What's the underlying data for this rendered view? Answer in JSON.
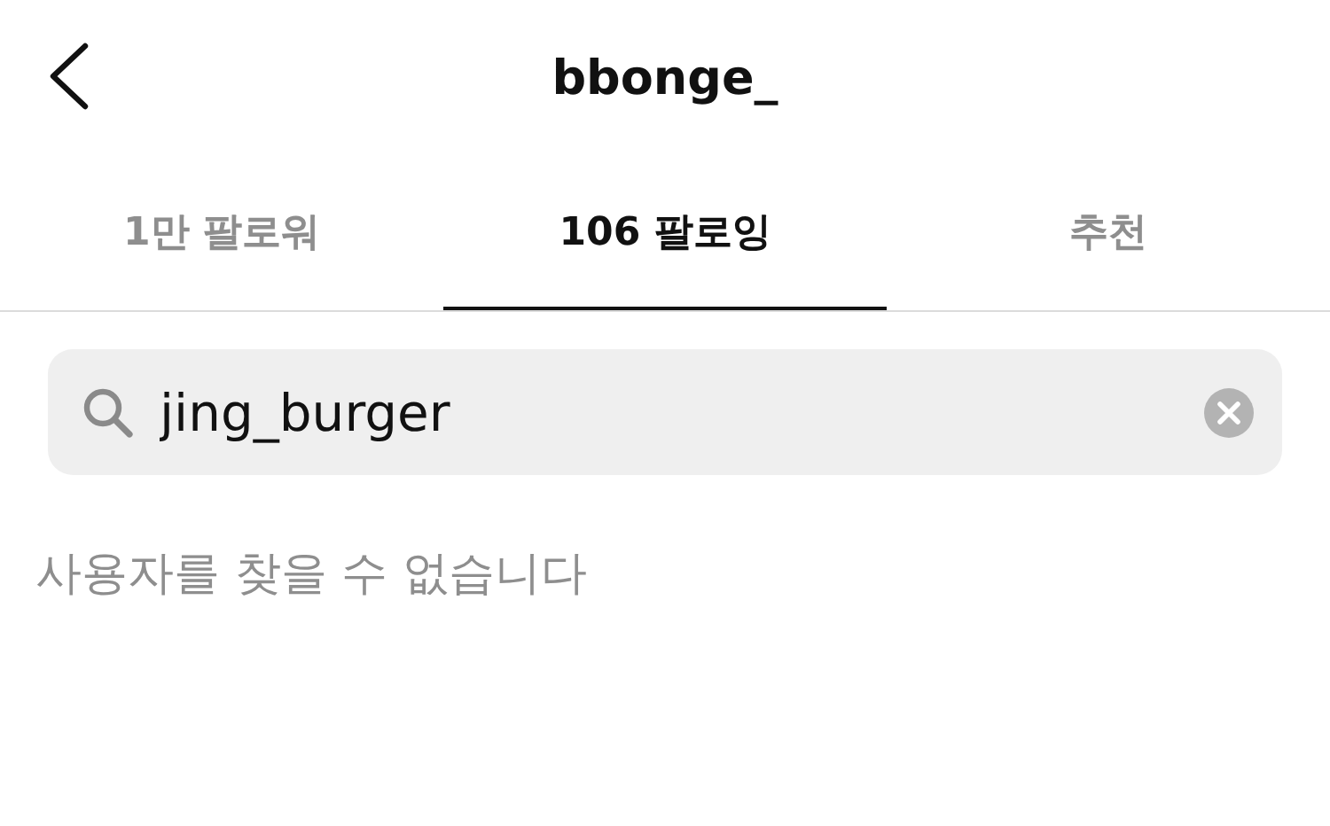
{
  "header": {
    "title": "bbonge_"
  },
  "tabs": [
    {
      "label": "1만 팔로워",
      "selected": false
    },
    {
      "label": "106 팔로잉",
      "selected": true
    },
    {
      "label": "추천",
      "selected": false
    }
  ],
  "search": {
    "value": "jing_burger"
  },
  "message": "사용자를 찾을 수 없습니다"
}
